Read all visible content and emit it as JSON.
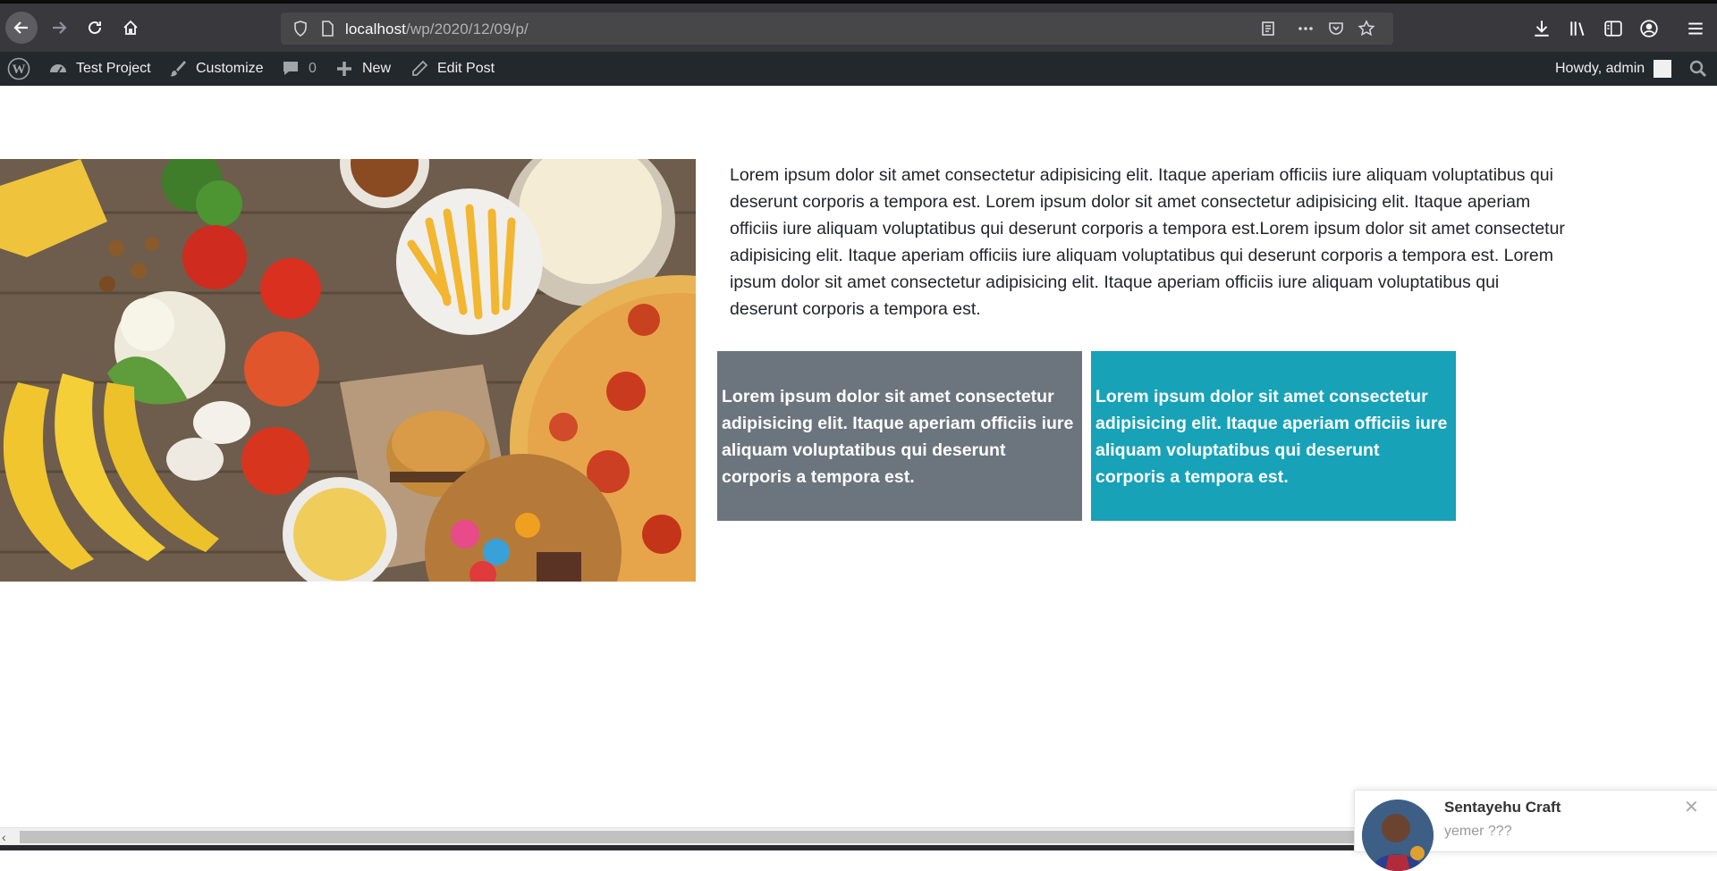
{
  "browser": {
    "url_host": "localhost",
    "url_path": "/wp/2020/12/09/p/"
  },
  "admin_bar": {
    "site_name": "Test Project",
    "customize": "Customize",
    "comments_count": "0",
    "new": "New",
    "edit_post": "Edit Post",
    "howdy": "Howdy, admin"
  },
  "content": {
    "intro": "Lorem ipsum dolor sit amet consectetur adipisicing elit. Itaque aperiam officiis iure aliquam voluptatibus qui deserunt corporis a tempora est. Lorem ipsum dolor sit amet consectetur adipisicing elit. Itaque aperiam officiis iure aliquam voluptatibus qui deserunt corporis a tempora est.Lorem ipsum dolor sit amet consectetur adipisicing elit. Itaque aperiam officiis iure aliquam voluptatibus qui deserunt corporis a tempora est. Lorem ipsum dolor sit amet consectetur adipisicing elit. Itaque aperiam officiis iure aliquam voluptatibus qui deserunt corporis a tempora est.",
    "card_gray": "Lorem ipsum dolor sit amet consectetur adipisicing elit. Itaque aperiam officiis iure aliquam voluptatibus qui deserunt corporis a tempora est.",
    "card_teal": "Lorem ipsum dolor sit amet consectetur adipisicing elit. Itaque aperiam officiis iure aliquam voluptatibus qui deserunt corporis a tempora est.",
    "card_gray_color": "#6c757d",
    "card_teal_color": "#17a2b8"
  },
  "chat": {
    "name": "Sentayehu Craft",
    "message": "yemer ???"
  }
}
